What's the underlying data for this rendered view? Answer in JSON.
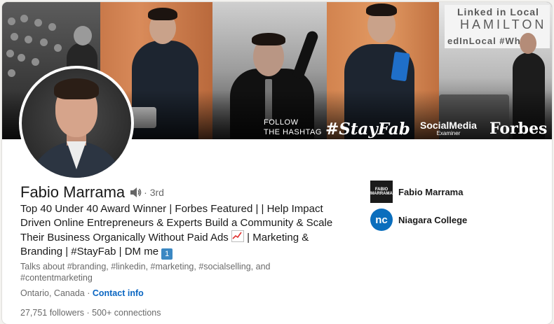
{
  "banner": {
    "follow_line1": "FOLLOW",
    "follow_line2": "THE HASHTAG",
    "hashtag": "#StayFab",
    "brand_social": "SocialMedia",
    "brand_social_sub": "Examiner",
    "brand_forbes": "Forbes",
    "sign_line1": "Linked in Local",
    "sign_line2": "HAMILTON",
    "sign_line3": "edInLocal #Whats"
  },
  "profile": {
    "name": "Fabio Marrama",
    "degree": "· 3rd",
    "headline_main": "Top 40 Under 40 Award Winner | Forbes Featured | | Help Impact Driven Online Entrepreneurs & Experts Build a Community & Scale Their Business Organically Without Paid Ads",
    "headline_tail": " | Marketing & Branding | #StayFab | DM me ",
    "talks_about": "Talks about #branding, #linkedin, #marketing, #socialselling, and #contentmarketing",
    "location": "Ontario, Canada ·",
    "contact_info": "Contact info",
    "followers": "27,751 followers",
    "connections": "· 500+ connections"
  },
  "organizations": [
    {
      "name": "Fabio Marrama",
      "logo_text_1": "FABIO",
      "logo_text_2": "MARRAMA",
      "icon": "company-logo"
    },
    {
      "name": "Niagara College",
      "logo_text": "nc",
      "icon": "school-logo"
    }
  ],
  "colors": {
    "link": "#0a66c2",
    "niagara_logo": "#0a6ebd",
    "company_logo": "#1b1b1b"
  }
}
